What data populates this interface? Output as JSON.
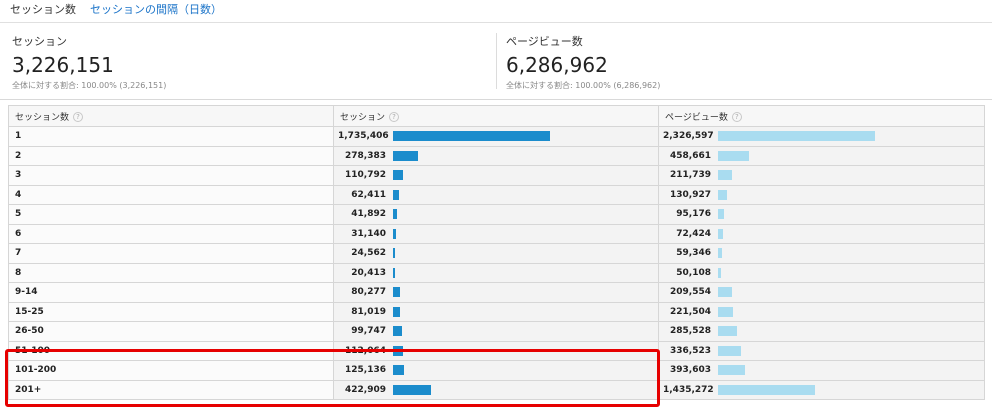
{
  "tabs": {
    "active": "セッション数",
    "link": "セッションの間隔（日数）"
  },
  "summary": {
    "sessions": {
      "label": "セッション",
      "value": "3,226,151",
      "sub": "全体に対する割合: 100.00% (3,226,151)"
    },
    "pageviews": {
      "label": "ページビュー数",
      "value": "6,286,962",
      "sub": "全体に対する割合: 100.00% (6,286,962)"
    }
  },
  "table": {
    "headers": [
      "セッション数",
      "セッション",
      "ページビュー数"
    ],
    "help_glyph": "?",
    "session_max": 1735406,
    "pageview_max": 2326597,
    "rows": [
      {
        "dim": "1",
        "sessions": "1,735,406",
        "s": 1735406,
        "pageviews": "2,326,597",
        "p": 2326597
      },
      {
        "dim": "2",
        "sessions": "278,383",
        "s": 278383,
        "pageviews": "458,661",
        "p": 458661
      },
      {
        "dim": "3",
        "sessions": "110,792",
        "s": 110792,
        "pageviews": "211,739",
        "p": 211739
      },
      {
        "dim": "4",
        "sessions": "62,411",
        "s": 62411,
        "pageviews": "130,927",
        "p": 130927
      },
      {
        "dim": "5",
        "sessions": "41,892",
        "s": 41892,
        "pageviews": "95,176",
        "p": 95176
      },
      {
        "dim": "6",
        "sessions": "31,140",
        "s": 31140,
        "pageviews": "72,424",
        "p": 72424
      },
      {
        "dim": "7",
        "sessions": "24,562",
        "s": 24562,
        "pageviews": "59,346",
        "p": 59346
      },
      {
        "dim": "8",
        "sessions": "20,413",
        "s": 20413,
        "pageviews": "50,108",
        "p": 50108
      },
      {
        "dim": "9-14",
        "sessions": "80,277",
        "s": 80277,
        "pageviews": "209,554",
        "p": 209554
      },
      {
        "dim": "15-25",
        "sessions": "81,019",
        "s": 81019,
        "pageviews": "221,504",
        "p": 221504
      },
      {
        "dim": "26-50",
        "sessions": "99,747",
        "s": 99747,
        "pageviews": "285,528",
        "p": 285528
      },
      {
        "dim": "51-100",
        "sessions": "112,064",
        "s": 112064,
        "pageviews": "336,523",
        "p": 336523
      },
      {
        "dim": "101-200",
        "sessions": "125,136",
        "s": 125136,
        "pageviews": "393,603",
        "p": 393603
      },
      {
        "dim": "201+",
        "sessions": "422,909",
        "s": 422909,
        "pageviews": "1,435,272",
        "p": 1435272
      }
    ]
  },
  "colors": {
    "session_bar": "#1b8ccc",
    "pageview_bar": "#a9dcf0",
    "highlight": "#e60000",
    "link": "#1a73c8"
  }
}
